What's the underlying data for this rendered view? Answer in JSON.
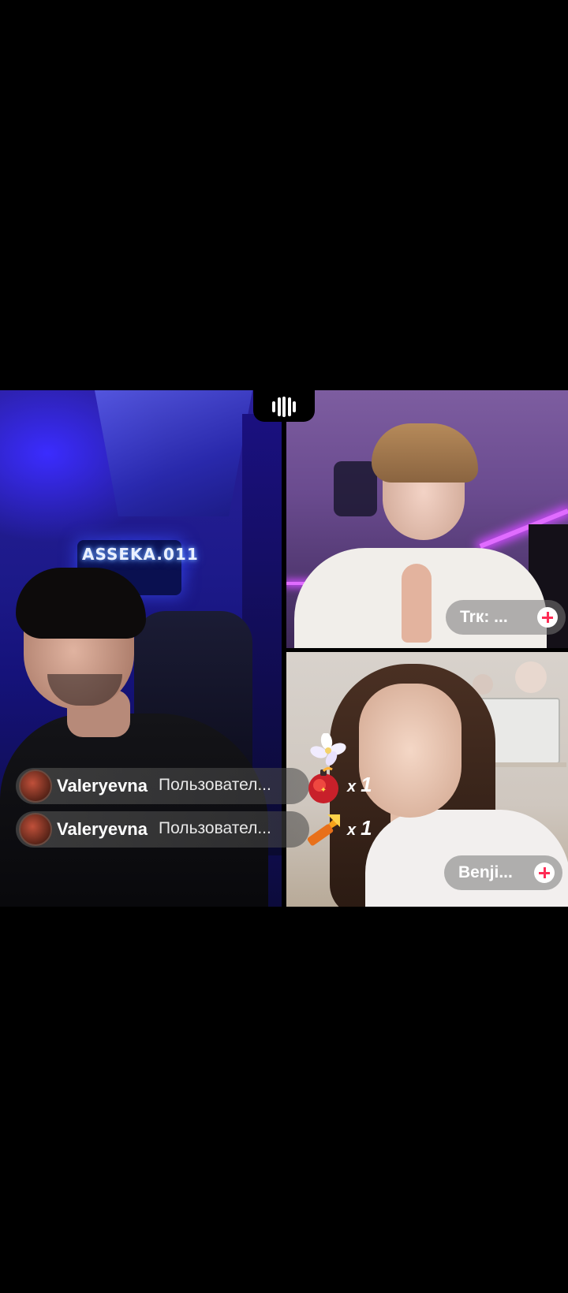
{
  "guests": [
    {
      "name_label": "Trк: ..."
    },
    {
      "name_label": "Benji..."
    }
  ],
  "host_background_sign": "ASSEKA.011",
  "gifts": [
    {
      "user": "Valeryevna",
      "text": "Пользовател...",
      "gift_icon": "rose-bomb-gift-icon",
      "count": "1",
      "multiplier": "x"
    },
    {
      "user": "Valeryevna",
      "text": "Пользовател...",
      "gift_icon": "popular-rocket-gift-icon",
      "count": "1",
      "multiplier": "x"
    }
  ],
  "colors": {
    "plus_accent": "#fe2c55",
    "pill_bg": "#787878"
  }
}
